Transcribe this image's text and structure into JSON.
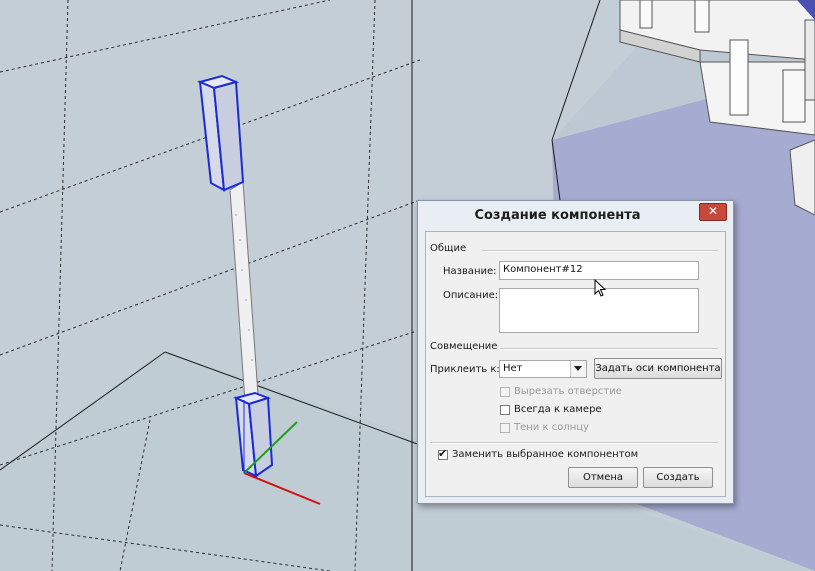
{
  "dialog": {
    "title": "Создание компонента",
    "close_label": "✕",
    "general_section": "Общие",
    "name_label": "Название:",
    "name_value": "Компонент#12",
    "description_label": "Описание:",
    "description_value": "",
    "alignment_section": "Совмещение",
    "glue_label": "Приклеить к:",
    "glue_value": "Нет",
    "set_axes_button": "Задать оси компонента",
    "cut_opening_label": "Вырезать отверстие",
    "cut_opening_checked": false,
    "face_camera_label": "Всегда к камере",
    "face_camera_checked": false,
    "shadows_face_sun_label": "Тени к солнцу",
    "shadows_face_sun_checked": false,
    "replace_selection_label": "Заменить выбранное компонентом",
    "replace_selection_checked": true,
    "cancel_button": "Отмена",
    "create_button": "Создать"
  },
  "colors": {
    "viewport_background": "#c3ced6",
    "selection_blue": "#1a2bd6",
    "axis_red": "#d01010",
    "axis_green": "#1aa01a",
    "close_button": "#c7493a"
  },
  "icons": [
    "close-icon",
    "dropdown-arrow-icon",
    "cursor-pointer-icon"
  ]
}
